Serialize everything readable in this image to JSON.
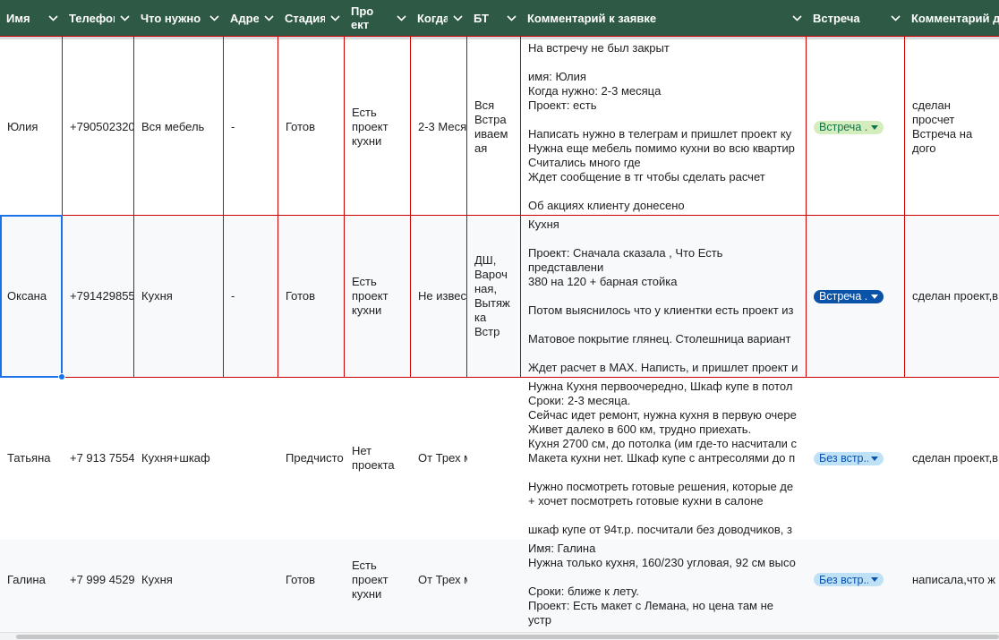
{
  "headers": [
    {
      "label": "Имя"
    },
    {
      "label": "Телефон"
    },
    {
      "label": "Что нужно"
    },
    {
      "label": "Адрес"
    },
    {
      "label": "Стадия"
    },
    {
      "label": "Про\nект"
    },
    {
      "label": "Когда"
    },
    {
      "label": "БТ"
    },
    {
      "label": "Комментарий к заявке"
    },
    {
      "label": "Встреча"
    },
    {
      "label": "Комментарий д"
    }
  ],
  "rows": [
    {
      "name": "Юлия",
      "phone": "+790502320",
      "need": "Вся мебель",
      "address": "-",
      "stage": "Готов",
      "project": "Есть проект кухни",
      "when": "2-3 Меся",
      "bt": "Вся Встра иваем ая",
      "comment": "На встречу не был закрыт\n\nимя: Юлия\nКогда нужно: 2-3 месяца\nПроект: есть\n\nНаписать нужно в телеграм и пришлет проект ку\nНужна еще мебель помимо кухни во всю квартир\nСчитались много где\nЖдет сообщение в тг чтобы сделать расчет\n\nОб акциях клиенту донесено",
      "meeting": "Встреча ...",
      "meeting_style": "green",
      "comment2": "сделан просчет\nВстреча на дого"
    },
    {
      "name": "Оксана",
      "phone": "+791429855",
      "need": "Кухня",
      "address": "-",
      "stage": "Готов",
      "project": "Есть проект кухни",
      "when": "Не извес",
      "bt": "ДШ, Вароч ная, Вытяж ка Встр",
      "comment": "Кухня\n\nПроект: Сначала сказала , Что Есть представлени\n380 на 120 + барная стойка\n\nПотом выяснилось что у клиентки есть проект из\n\nМатовое покрытие глянец. Столешница вариант\n\nЖдет расчет в MAX. Написть, и пришлет проект и",
      "meeting": "Встреча ...",
      "meeting_style": "blue",
      "comment2": "сделан проект,в"
    },
    {
      "name": "Татьяна",
      "phone": "+7 913 7554",
      "need": "Кухня+шкаф",
      "address": "",
      "stage": "Предчисто",
      "project": "Нет проекта",
      "when": "От Трех м",
      "bt": "",
      "comment": "Нужна Кухня первоочередно, Шкаф купе в потол\nСроки: 2-3 месяца.\nСейчас идет ремонт, нужна кухня в первую очере\nЖивет далеко в 600 км, трудно приехать.\nКухня 2700 см, до потолка (им где-то насчитали с\nМакета кухни нет. Шкаф купе с антресолями до п\n\nНужно посмотреть готовые решения, которые де\n+ хочет посмотреть готовые кухни в салоне\n\nшкаф купе от 94т.р. посчитали без доводчиков, з",
      "meeting": "Без встр...",
      "meeting_style": "light",
      "comment2": "сделан проект,в"
    },
    {
      "name": "Галина",
      "phone": "+7 999 4529",
      "need": "Кухня",
      "address": "",
      "stage": "Готов",
      "project": "Есть проект кухни",
      "when": "От Трех м",
      "bt": "",
      "comment": "Имя: Галина\nНужна только кухня, 160/230 угловая, 92 см высо\n\nСроки: ближе к лету.\nПроект: Есть макет с Лемана, но цена там не устр\n\nН",
      "meeting": "Без встр...",
      "meeting_style": "light",
      "comment2": "написала,что ж"
    }
  ]
}
